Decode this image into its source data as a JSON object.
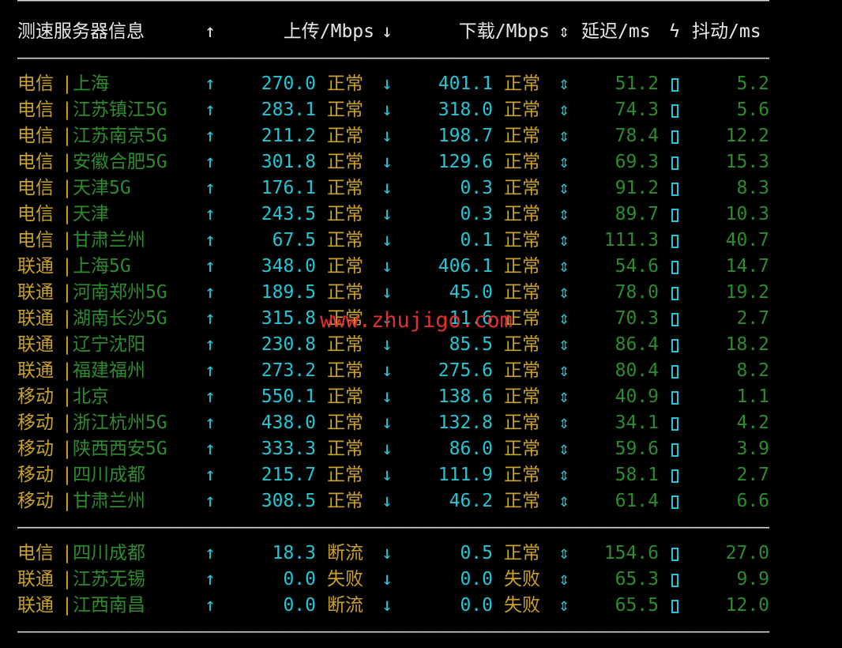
{
  "header": {
    "title": "测速服务器信息",
    "upload_arrow": "↑",
    "upload": "上传/Mbps",
    "download_arrow": "↓",
    "download": "下载/Mbps",
    "updown_arrow": "⇕",
    "latency": "延迟/ms",
    "bolt": "ϟ",
    "jitter": "抖动/ms"
  },
  "divider_text": "————————————————————————————————————————————————————————————————————————————————————————————",
  "rows": [
    {
      "isp": "电信",
      "sep": "|",
      "city": "上海",
      "up_arrow": "↑",
      "up": "270.0",
      "up_status": "正常",
      "down_arrow": "↓",
      "down": "401.1",
      "down_status": "正常",
      "ud_arrow": "⇕",
      "latency": "51.2",
      "jitter": "5.2"
    },
    {
      "isp": "电信",
      "sep": "|",
      "city": "江苏镇江5G",
      "up_arrow": "↑",
      "up": "283.1",
      "up_status": "正常",
      "down_arrow": "↓",
      "down": "318.0",
      "down_status": "正常",
      "ud_arrow": "⇕",
      "latency": "74.3",
      "jitter": "5.6"
    },
    {
      "isp": "电信",
      "sep": "|",
      "city": "江苏南京5G",
      "up_arrow": "↑",
      "up": "211.2",
      "up_status": "正常",
      "down_arrow": "↓",
      "down": "198.7",
      "down_status": "正常",
      "ud_arrow": "⇕",
      "latency": "78.4",
      "jitter": "12.2"
    },
    {
      "isp": "电信",
      "sep": "|",
      "city": "安徽合肥5G",
      "up_arrow": "↑",
      "up": "301.8",
      "up_status": "正常",
      "down_arrow": "↓",
      "down": "129.6",
      "down_status": "正常",
      "ud_arrow": "⇕",
      "latency": "69.3",
      "jitter": "15.3"
    },
    {
      "isp": "电信",
      "sep": "|",
      "city": "天津5G",
      "up_arrow": "↑",
      "up": "176.1",
      "up_status": "正常",
      "down_arrow": "↓",
      "down": "0.3",
      "down_status": "正常",
      "ud_arrow": "⇕",
      "latency": "91.2",
      "jitter": "8.3"
    },
    {
      "isp": "电信",
      "sep": "|",
      "city": "天津",
      "up_arrow": "↑",
      "up": "243.5",
      "up_status": "正常",
      "down_arrow": "↓",
      "down": "0.3",
      "down_status": "正常",
      "ud_arrow": "⇕",
      "latency": "89.7",
      "jitter": "10.3"
    },
    {
      "isp": "电信",
      "sep": "|",
      "city": "甘肃兰州",
      "up_arrow": "↑",
      "up": "67.5",
      "up_status": "正常",
      "down_arrow": "↓",
      "down": "0.1",
      "down_status": "正常",
      "ud_arrow": "⇕",
      "latency": "111.3",
      "jitter": "40.7"
    },
    {
      "isp": "联通",
      "sep": "|",
      "city": "上海5G",
      "up_arrow": "↑",
      "up": "348.0",
      "up_status": "正常",
      "down_arrow": "↓",
      "down": "406.1",
      "down_status": "正常",
      "ud_arrow": "⇕",
      "latency": "54.6",
      "jitter": "14.7"
    },
    {
      "isp": "联通",
      "sep": "|",
      "city": "河南郑州5G",
      "up_arrow": "↑",
      "up": "189.5",
      "up_status": "正常",
      "down_arrow": "↓",
      "down": "45.0",
      "down_status": "正常",
      "ud_arrow": "⇕",
      "latency": "78.0",
      "jitter": "19.2"
    },
    {
      "isp": "联通",
      "sep": "|",
      "city": "湖南长沙5G",
      "up_arrow": "↑",
      "up": "315.8",
      "up_status": "正常",
      "down_arrow": "↓",
      "down": "11.6",
      "down_status": "正常",
      "ud_arrow": "⇕",
      "latency": "70.3",
      "jitter": "2.7"
    },
    {
      "isp": "联通",
      "sep": "|",
      "city": "辽宁沈阳",
      "up_arrow": "↑",
      "up": "230.8",
      "up_status": "正常",
      "down_arrow": "↓",
      "down": "85.5",
      "down_status": "正常",
      "ud_arrow": "⇕",
      "latency": "86.4",
      "jitter": "18.2"
    },
    {
      "isp": "联通",
      "sep": "|",
      "city": "福建福州",
      "up_arrow": "↑",
      "up": "273.2",
      "up_status": "正常",
      "down_arrow": "↓",
      "down": "275.6",
      "down_status": "正常",
      "ud_arrow": "⇕",
      "latency": "80.4",
      "jitter": "8.2"
    },
    {
      "isp": "移动",
      "sep": "|",
      "city": "北京",
      "up_arrow": "↑",
      "up": "550.1",
      "up_status": "正常",
      "down_arrow": "↓",
      "down": "138.6",
      "down_status": "正常",
      "ud_arrow": "⇕",
      "latency": "40.9",
      "jitter": "1.1"
    },
    {
      "isp": "移动",
      "sep": "|",
      "city": "浙江杭州5G",
      "up_arrow": "↑",
      "up": "438.0",
      "up_status": "正常",
      "down_arrow": "↓",
      "down": "132.8",
      "down_status": "正常",
      "ud_arrow": "⇕",
      "latency": "34.1",
      "jitter": "4.2"
    },
    {
      "isp": "移动",
      "sep": "|",
      "city": "陕西西安5G",
      "up_arrow": "↑",
      "up": "333.3",
      "up_status": "正常",
      "down_arrow": "↓",
      "down": "86.0",
      "down_status": "正常",
      "ud_arrow": "⇕",
      "latency": "59.6",
      "jitter": "3.9"
    },
    {
      "isp": "移动",
      "sep": "|",
      "city": "四川成都",
      "up_arrow": "↑",
      "up": "215.7",
      "up_status": "正常",
      "down_arrow": "↓",
      "down": "111.9",
      "down_status": "正常",
      "ud_arrow": "⇕",
      "latency": "58.1",
      "jitter": "2.7"
    },
    {
      "isp": "移动",
      "sep": "|",
      "city": "甘肃兰州",
      "up_arrow": "↑",
      "up": "308.5",
      "up_status": "正常",
      "down_arrow": "↓",
      "down": "46.2",
      "down_status": "正常",
      "ud_arrow": "⇕",
      "latency": "61.4",
      "jitter": "6.6"
    }
  ],
  "extra_rows": [
    {
      "isp": "电信",
      "sep": "|",
      "city": "四川成都",
      "up_arrow": "↑",
      "up": "18.3",
      "up_status": "断流",
      "down_arrow": "↓",
      "down": "0.5",
      "down_status": "正常",
      "ud_arrow": "⇕",
      "latency": "154.6",
      "jitter": "27.0"
    },
    {
      "isp": "联通",
      "sep": "|",
      "city": "江苏无锡",
      "up_arrow": "↑",
      "up": "0.0",
      "up_status": "失败",
      "down_arrow": "↓",
      "down": "0.0",
      "down_status": "失败",
      "ud_arrow": "⇕",
      "latency": "65.3",
      "jitter": "9.9"
    },
    {
      "isp": "联通",
      "sep": "|",
      "city": "江西南昌",
      "up_arrow": "↑",
      "up": "0.0",
      "up_status": "断流",
      "down_arrow": "↓",
      "down": "0.0",
      "down_status": "失败",
      "ud_arrow": "⇕",
      "latency": "65.5",
      "jitter": "12.0"
    }
  ],
  "watermark": "www.zhujigo.com",
  "colors": {
    "background": "#000000",
    "isp": "#c9a227",
    "city": "#2e8b2e",
    "cyan": "#29c4d4",
    "status": "#c9a227",
    "latency_jitter": "#2e8b2e",
    "watermark": "#e03030"
  }
}
